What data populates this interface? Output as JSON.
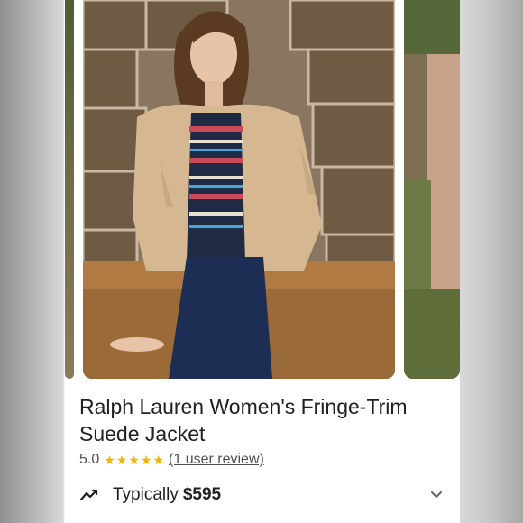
{
  "product": {
    "title": "Ralph Lauren Women's Fringe-Trim Suede Jacket",
    "rating": {
      "score": "5.0",
      "stars_icon": "★★★★★",
      "star_color": "#f4b400",
      "review_link": "(1 user review)"
    },
    "price": {
      "label": "Typically",
      "value": "$595"
    }
  },
  "icons": {
    "trend": "trending-line-icon",
    "expand": "chevron-down-icon"
  }
}
